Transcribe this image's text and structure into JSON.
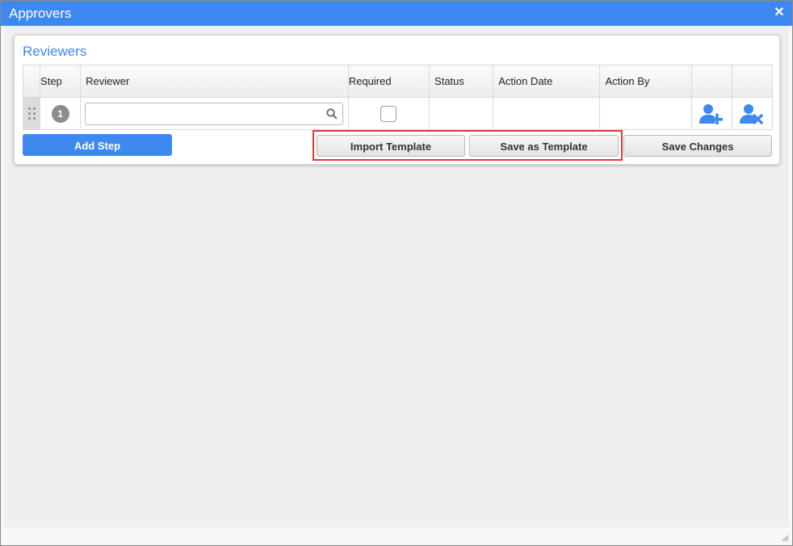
{
  "window": {
    "title": "Approvers",
    "close_symbol": "✕"
  },
  "reviewers": {
    "title": "Reviewers",
    "columns": [
      "Step",
      "Reviewer",
      "Required",
      "Status",
      "Action Date",
      "Action By"
    ],
    "rows": [
      {
        "step": "1",
        "reviewer_value": "",
        "required": false,
        "status": "",
        "action_date": "",
        "action_by": ""
      }
    ]
  },
  "buttons": {
    "add_step": "Add Step",
    "import_template": "Import Template",
    "save_as_template": "Save as Template",
    "save_changes": "Save Changes"
  },
  "icons": {
    "drag": "drag-handle-icon",
    "search": "search-icon",
    "add_user": "user-plus-icon",
    "remove_user": "user-remove-icon",
    "resize": "resize-grip-icon"
  },
  "colors": {
    "accent": "#3d89ef",
    "highlight": "#e53935"
  }
}
